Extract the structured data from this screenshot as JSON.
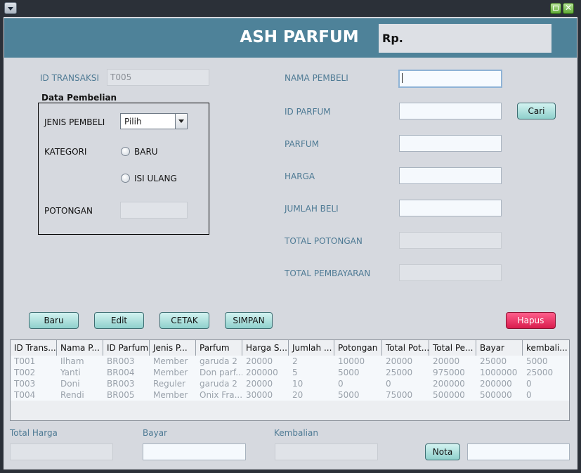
{
  "app": {
    "title": "ASH PARFUM",
    "rp_label": "Rp."
  },
  "form_left": {
    "id_transaksi_label": "ID TRANSAKSI",
    "id_transaksi_value": "T005",
    "group_title": "Data Pembelian",
    "jenis_pembeli_label": "JENIS PEMBELI",
    "jenis_pembeli_value": "Pilih",
    "kategori_label": "KATEGORI",
    "kategori_options": [
      "BARU",
      "ISI ULANG"
    ],
    "potongan_label": "POTONGAN"
  },
  "form_right": {
    "nama_pembeli_label": "NAMA PEMBELI",
    "id_parfum_label": "ID PARFUM",
    "cari_button": "Cari",
    "parfum_label": "PARFUM",
    "harga_label": "HARGA",
    "jumlah_beli_label": "JUMLAH BELI",
    "total_potongan_label": "TOTAL POTONGAN",
    "total_pembayaran_label": "TOTAL PEMBAYARAN"
  },
  "actions": {
    "baru": "Baru",
    "edit": "Edit",
    "cetak": "CETAK",
    "simpan": "SIMPAN",
    "hapus": "Hapus"
  },
  "table": {
    "columns": [
      "ID Trans...",
      "Nama P...",
      "ID Parfum",
      "Jenis P...",
      "Parfum",
      "Harga S...",
      "Jumlah ...",
      "Potongan",
      "Total Pot...",
      "Total Pe...",
      "Bayar",
      "kembali..."
    ],
    "rows": [
      [
        "T001",
        "Ilham",
        "BR003",
        "Member",
        "garuda 2",
        "20000",
        "2",
        "10000",
        "20000",
        "20000",
        "25000",
        "5000"
      ],
      [
        "T002",
        "Yanti",
        "BR004",
        "Member",
        "Don parf...",
        "200000",
        "5",
        "5000",
        "25000",
        "975000",
        "1000000",
        "25000"
      ],
      [
        "T003",
        "Doni",
        "BR003",
        "Reguler",
        "garuda 2",
        "20000",
        "10",
        "0",
        "0",
        "200000",
        "200000",
        "0"
      ],
      [
        "T004",
        "Rendi",
        "BR005",
        "Member",
        "Onix Fra...",
        "30000",
        "20",
        "5000",
        "75000",
        "500000",
        "500000",
        "0"
      ]
    ]
  },
  "footer": {
    "total_harga_label": "Total Harga",
    "bayar_label": "Bayar",
    "kembalian_label": "Kembalian",
    "nota_button": "Nota"
  },
  "colors": {
    "header_bg": "#4e8299",
    "label_text": "#4e7a94",
    "hapus_bg": "#d81c4d",
    "button_teal": "#8fd0cc"
  }
}
